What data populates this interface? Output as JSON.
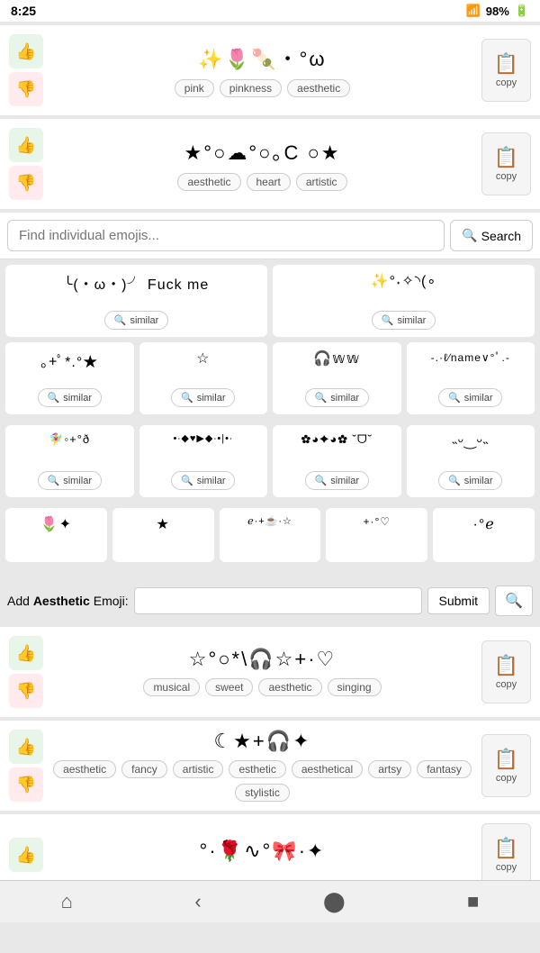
{
  "statusBar": {
    "time": "8:25",
    "battery": "98%",
    "wifi": "WiFi"
  },
  "card1": {
    "emoji": "✨🌷🍡・°ω",
    "tags": [
      "pink",
      "pinkness",
      "aesthetic"
    ],
    "copyLabel": "copy"
  },
  "card2": {
    "emoji": "★°○☁°○｡C ○★",
    "tags": [
      "aesthetic",
      "heart",
      "artistic"
    ],
    "copyLabel": "copy"
  },
  "searchBar": {
    "placeholder": "Find individual emojis...",
    "searchLabel": "Search"
  },
  "partialCards": {
    "left": "╰(・ω・)╯ Fuck me",
    "right": "✨°˖✧◝(∘"
  },
  "gridItems": [
    {
      "emoji": "｡+ﾟ*.°★",
      "hasSimilar": true
    },
    {
      "emoji": "☆",
      "hasSimilar": true
    },
    {
      "emoji": "🎧𝕨𝕨",
      "hasSimilar": true
    },
    {
      "emoji": "-.°ℓ/name∨°ﾟ.-",
      "hasSimilar": true
    }
  ],
  "gridRow2": [
    {
      "emoji": "🧚‍♀️◦+°ð",
      "hasSimilar": true
    },
    {
      "emoji": "•｡∙◆◇▶◆∙｡•|•｡∙",
      "hasSimilar": true
    },
    {
      "emoji": "✿｡◕✦◕｡✿ ˘ᗜ˘",
      "hasSimilar": true
    },
    {
      "emoji": "˵ᵕ‿ᵕ˵",
      "hasSimilar": true
    }
  ],
  "gridRow3": [
    {
      "emoji": "🌷✦",
      "hasSimilar": false
    },
    {
      "emoji": "★",
      "hasSimilar": false
    },
    {
      "emoji": "ℯ·+☕·☆",
      "hasSimilar": false
    },
    {
      "emoji": "+·°♡",
      "hasSimilar": false
    },
    {
      "emoji": "·°ℯ",
      "hasSimilar": false
    }
  ],
  "addBar": {
    "labelStart": "Add ",
    "labelBold": "Aesthetic",
    "labelEnd": " Emoji:",
    "placeholder": "",
    "submitLabel": "Submit"
  },
  "card3": {
    "emoji": "☆°○*\\🎧☆+·♡",
    "tags": [
      "musical",
      "sweet",
      "aesthetic",
      "singing"
    ],
    "copyLabel": "copy"
  },
  "card4": {
    "emoji": "☾★+🎧✦",
    "tags": [
      "aesthetic",
      "fancy",
      "artistic",
      "esthetic",
      "aesthetical",
      "artsy",
      "fantasy",
      "stylistic"
    ],
    "copyLabel": "copy"
  },
  "card5": {
    "emoji": "°·🌹∿°🎀·✦",
    "copyLabel": "copy"
  },
  "bottomNav": {
    "homeIcon": "⌂",
    "backIcon": "‹",
    "circleIcon": "●",
    "squareIcon": "■"
  }
}
